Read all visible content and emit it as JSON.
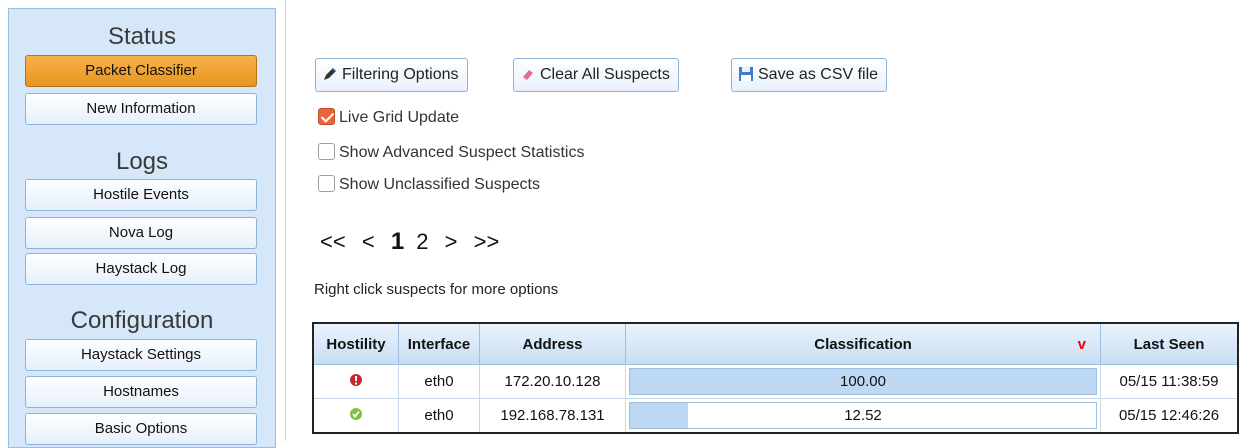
{
  "sidebar": {
    "status_title": "Status",
    "status_items": [
      "Packet Classifier",
      "New Information"
    ],
    "logs_title": "Logs",
    "logs_items": [
      "Hostile Events",
      "Nova Log",
      "Haystack Log"
    ],
    "config_title": "Configuration",
    "config_items": [
      "Haystack Settings",
      "Hostnames",
      "Basic Options"
    ],
    "active_item": "Packet Classifier",
    "active_color": "#eea02f"
  },
  "toolbar": {
    "filtering_label": "Filtering Options",
    "clear_label": "Clear All Suspects",
    "csv_label": "Save as CSV file"
  },
  "options": {
    "live_grid": {
      "label": "Live Grid Update",
      "checked": true
    },
    "advanced_stats": {
      "label": "Show Advanced Suspect Statistics",
      "checked": false
    },
    "unclassified": {
      "label": "Show Unclassified Suspects",
      "checked": false
    }
  },
  "pager": {
    "first": "<<",
    "prev": "<",
    "pages": [
      "1",
      "2"
    ],
    "current": "1",
    "next": ">",
    "last": ">>"
  },
  "hint": "Right click suspects for more options",
  "grid": {
    "headers": [
      "Hostility",
      "Interface",
      "Address",
      "Classification",
      "Last Seen"
    ],
    "sort_indicator": "v",
    "rows": [
      {
        "hostility_icon": "hostile-icon",
        "interface": "eth0",
        "address": "172.20.10.128",
        "classification": "100.00",
        "classification_pct": 100,
        "last_seen": "05/15 11:38:59"
      },
      {
        "hostility_icon": "benign-icon",
        "interface": "eth0",
        "address": "192.168.78.131",
        "classification": "12.52",
        "classification_pct": 12.52,
        "last_seen": "05/15 12:46:26"
      }
    ],
    "colors": {
      "hostile": "#c62828",
      "benign": "#7cc243",
      "bar": "#bed8f3"
    }
  }
}
